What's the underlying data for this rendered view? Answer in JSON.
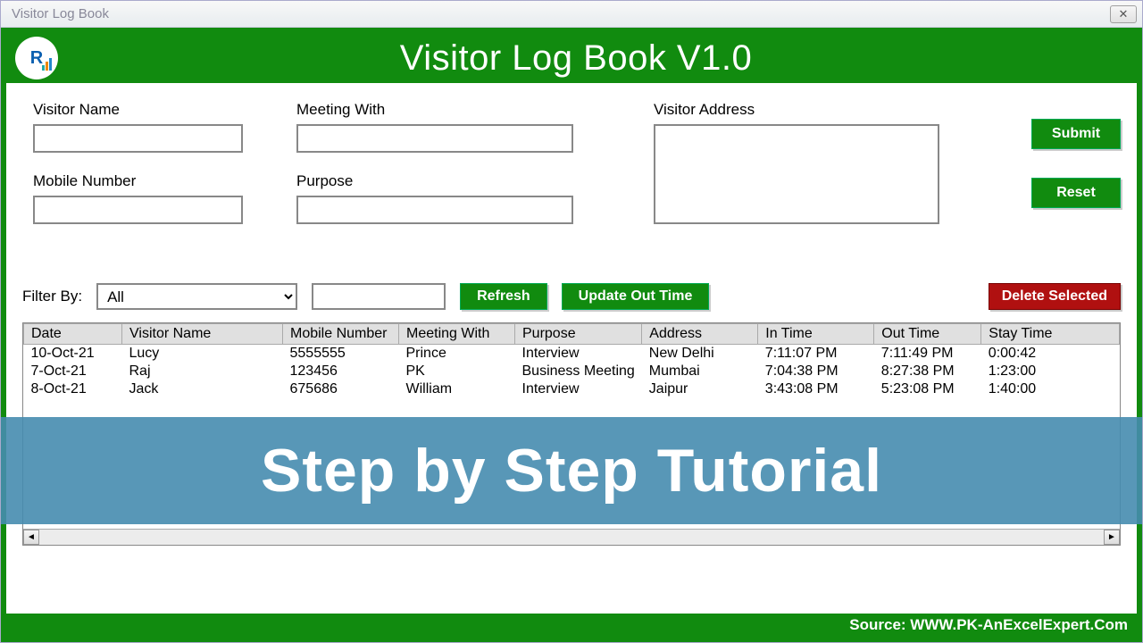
{
  "window": {
    "title": "Visitor Log Book"
  },
  "header": {
    "title": "Visitor Log Book V1.0"
  },
  "form": {
    "visitor_name_label": "Visitor Name",
    "visitor_name_value": "",
    "mobile_label": "Mobile Number",
    "mobile_value": "",
    "meeting_label": "Meeting With",
    "meeting_value": "",
    "purpose_label": "Purpose",
    "purpose_value": "",
    "address_label": "Visitor Address",
    "address_value": "",
    "submit_label": "Submit",
    "reset_label": "Reset"
  },
  "filter": {
    "label": "Filter By:",
    "selected": "All",
    "text_value": "",
    "refresh_label": "Refresh",
    "update_label": "Update Out Time",
    "delete_label": "Delete Selected"
  },
  "table": {
    "headers": [
      "Date",
      "Visitor Name",
      "Mobile Number",
      "Meeting With",
      "Purpose",
      "Address",
      "In Time",
      "Out Time",
      "Stay Time"
    ],
    "rows": [
      {
        "date": "10-Oct-21",
        "name": "Lucy",
        "mobile": "5555555",
        "meeting": "Prince",
        "purpose": "Interview",
        "address": "New Delhi",
        "in": "7:11:07 PM",
        "out": "7:11:49 PM",
        "stay": "0:00:42"
      },
      {
        "date": "7-Oct-21",
        "name": "Raj",
        "mobile": "123456",
        "meeting": "PK",
        "purpose": "Business Meeting",
        "address": "Mumbai",
        "in": "7:04:38 PM",
        "out": "8:27:38 PM",
        "stay": "1:23:00"
      },
      {
        "date": "8-Oct-21",
        "name": "Jack",
        "mobile": "675686",
        "meeting": "William",
        "purpose": "Interview",
        "address": "Jaipur",
        "in": "3:43:08 PM",
        "out": "5:23:08 PM",
        "stay": "1:40:00"
      }
    ]
  },
  "footer": {
    "source": "Source: WWW.PK-AnExcelExpert.Com"
  },
  "overlay": {
    "text": "Step by Step Tutorial"
  }
}
